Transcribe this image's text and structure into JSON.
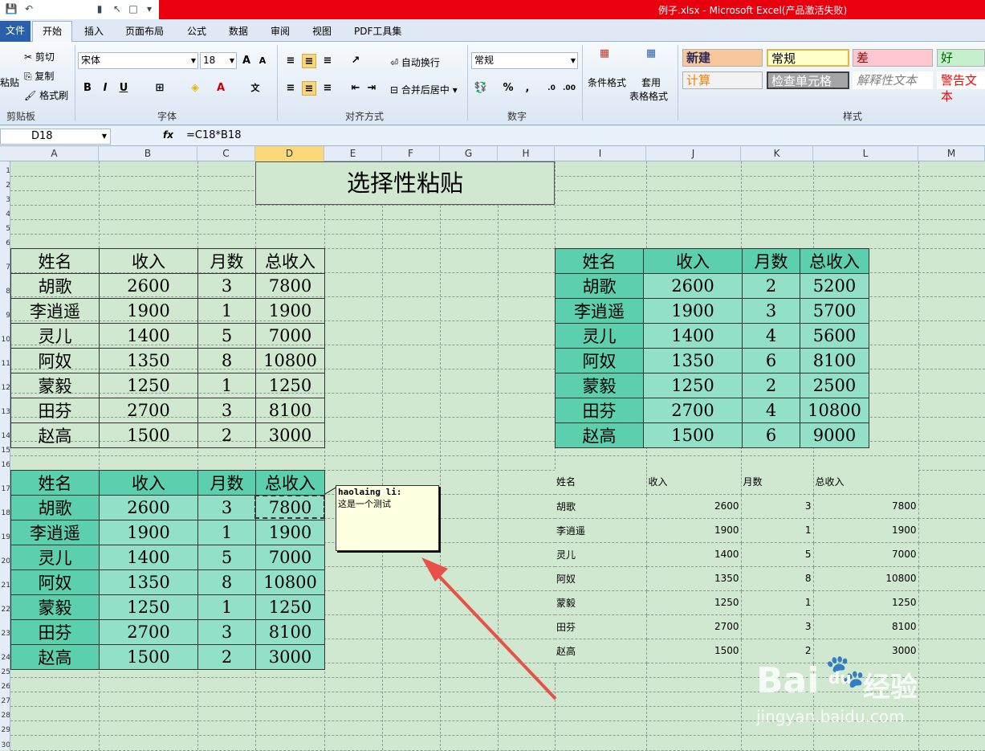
{
  "window": {
    "title": "例子.xlsx - Microsoft Excel(产品激活失败)"
  },
  "tabs": [
    "文件",
    "开始",
    "插入",
    "页面布局",
    "公式",
    "数据",
    "审阅",
    "视图",
    "PDF工具集"
  ],
  "ribbon": {
    "clipboard": {
      "paste": "粘贴",
      "cut": "剪切",
      "copy": "复制",
      "format_painter": "格式刷",
      "label": "剪贴板"
    },
    "font": {
      "name": "宋体",
      "size": "18",
      "label": "字体"
    },
    "align": {
      "wrap": "自动换行",
      "merge": "合并后居中",
      "label": "对齐方式"
    },
    "number": {
      "format": "常规",
      "label": "数字"
    },
    "styles": {
      "cond": "条件格式",
      "table1": "套用",
      "table2": "表格格式",
      "label": "样式",
      "cells": [
        "新建",
        "常规",
        "差",
        "好",
        "计算",
        "检查单元格",
        "解释性文本",
        "警告文本"
      ]
    }
  },
  "formula_bar": {
    "name_box": "D18",
    "fx": "fx",
    "formula": "=C18*B18"
  },
  "columns": [
    "A",
    "B",
    "C",
    "D",
    "E",
    "F",
    "G",
    "H",
    "I",
    "J",
    "K",
    "L",
    "M"
  ],
  "rows": [
    "1",
    "2",
    "3",
    "4",
    "5",
    "6",
    "7",
    "8",
    "9",
    "10",
    "11",
    "12",
    "13",
    "14",
    "15",
    "16",
    "17",
    "18",
    "19",
    "20",
    "21",
    "22",
    "23",
    "24",
    "25",
    "26",
    "27",
    "28",
    "29",
    "30"
  ],
  "sheet_title": "选择性粘贴",
  "table1": {
    "headers": [
      "姓名",
      "收入",
      "月数",
      "总收入"
    ],
    "rows": [
      [
        "胡歌",
        "2600",
        "3",
        "7800"
      ],
      [
        "李逍遥",
        "1900",
        "1",
        "1900"
      ],
      [
        "灵儿",
        "1400",
        "5",
        "7000"
      ],
      [
        "阿奴",
        "1350",
        "8",
        "10800"
      ],
      [
        "蒙毅",
        "1250",
        "1",
        "1250"
      ],
      [
        "田芬",
        "2700",
        "3",
        "8100"
      ],
      [
        "赵高",
        "1500",
        "2",
        "3000"
      ]
    ]
  },
  "table2": {
    "headers": [
      "姓名",
      "收入",
      "月数",
      "总收入"
    ],
    "rows": [
      [
        "胡歌",
        "2600",
        "2",
        "5200"
      ],
      [
        "李逍遥",
        "1900",
        "3",
        "5700"
      ],
      [
        "灵儿",
        "1400",
        "4",
        "5600"
      ],
      [
        "阿奴",
        "1350",
        "6",
        "8100"
      ],
      [
        "蒙毅",
        "1250",
        "2",
        "2500"
      ],
      [
        "田芬",
        "2700",
        "4",
        "10800"
      ],
      [
        "赵高",
        "1500",
        "6",
        "9000"
      ]
    ]
  },
  "table3": {
    "headers": [
      "姓名",
      "收入",
      "月数",
      "总收入"
    ],
    "rows": [
      [
        "胡歌",
        "2600",
        "3",
        "7800"
      ],
      [
        "李逍遥",
        "1900",
        "1",
        "1900"
      ],
      [
        "灵儿",
        "1400",
        "5",
        "7000"
      ],
      [
        "阿奴",
        "1350",
        "8",
        "10800"
      ],
      [
        "蒙毅",
        "1250",
        "1",
        "1250"
      ],
      [
        "田芬",
        "2700",
        "3",
        "8100"
      ],
      [
        "赵高",
        "1500",
        "2",
        "3000"
      ]
    ]
  },
  "table4": {
    "headers": [
      "姓名",
      "收入",
      "月数",
      "总收入"
    ],
    "rows": [
      [
        "胡歌",
        "2600",
        "3",
        "7800"
      ],
      [
        "李逍遥",
        "1900",
        "1",
        "1900"
      ],
      [
        "灵儿",
        "1400",
        "5",
        "7000"
      ],
      [
        "阿奴",
        "1350",
        "8",
        "10800"
      ],
      [
        "蒙毅",
        "1250",
        "1",
        "1250"
      ],
      [
        "田芬",
        "2700",
        "3",
        "8100"
      ],
      [
        "赵高",
        "1500",
        "2",
        "3000"
      ]
    ]
  },
  "comment": {
    "author": "haolaing li:",
    "text": "这是一个测试"
  },
  "watermark": {
    "brand": "Bai",
    "paw": "du",
    "cn": "经验",
    "url": "jingyan.baidu.com"
  },
  "colors": {
    "header_teal": "#5ccfae",
    "cell_teal": "#93e0c9",
    "sheet_green": "#cfe8cf",
    "title_red": "#e8000e",
    "arrow": "#e8504a"
  }
}
